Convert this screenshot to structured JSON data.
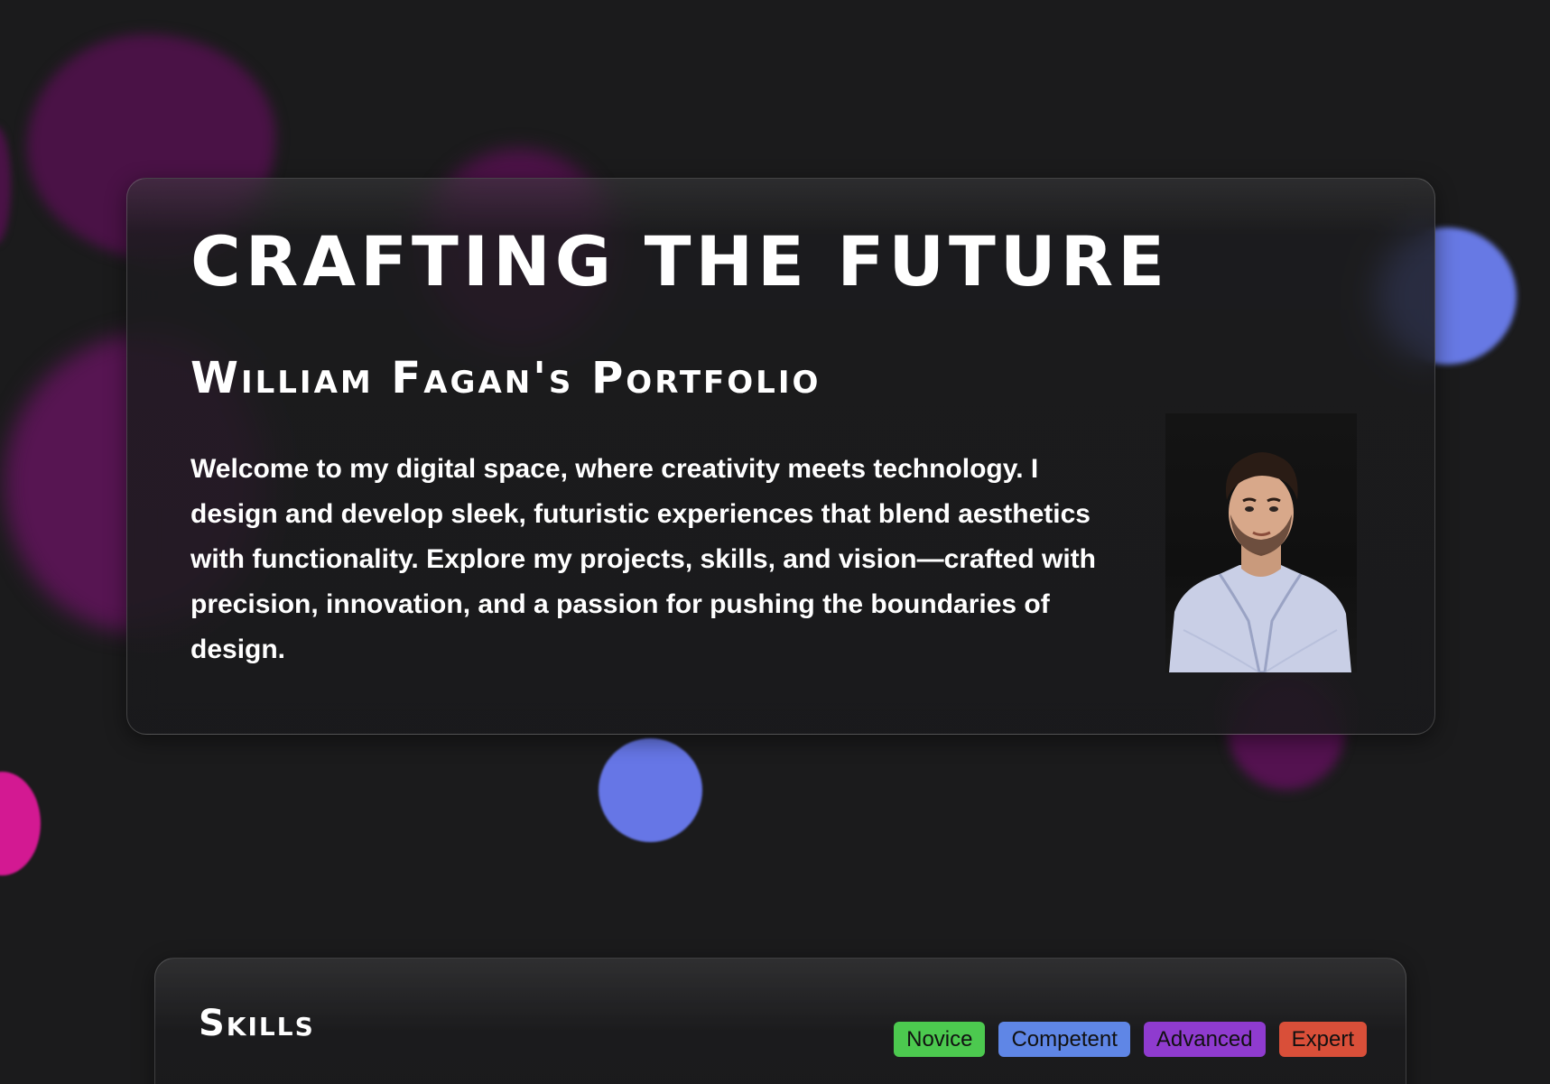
{
  "hero": {
    "title": "CRAFTING THE FUTURE",
    "subtitle": "William Fagan's Portfolio",
    "intro": "Welcome to my digital space, where creativity meets technology. I design and develop sleek, futuristic experiences that blend aesthetics with functionality. Explore my projects, skills, and vision—crafted with precision, innovation, and a passion for pushing the boundaries of design.",
    "portrait_icon": "person-photo"
  },
  "skills": {
    "title": "Skills",
    "legend": [
      {
        "label": "Novice",
        "color": "#4cc94f"
      },
      {
        "label": "Competent",
        "color": "#5f86e6"
      },
      {
        "label": "Advanced",
        "color": "#8f3bcf"
      },
      {
        "label": "Expert",
        "color": "#d94f39"
      }
    ]
  },
  "colors": {
    "background": "#1b1b1c",
    "blob_magenta": "#4a1246",
    "blob_blue": "#6676e6",
    "blob_pink": "#d31992"
  }
}
